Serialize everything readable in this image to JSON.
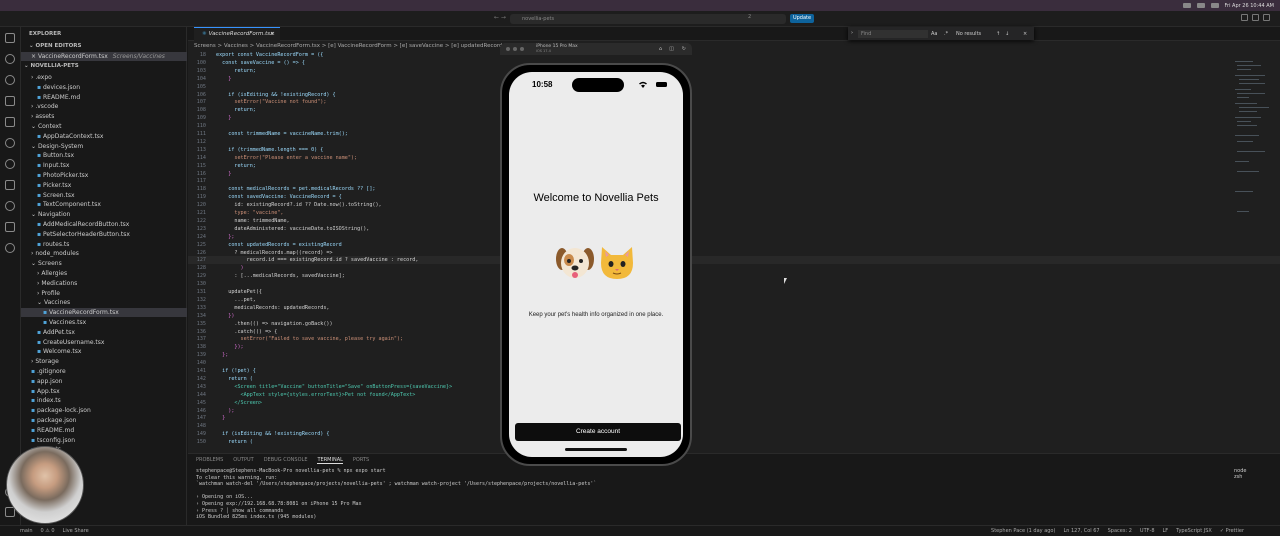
{
  "titlebar": {
    "search_text": "novellia-pets",
    "badge_count": "2",
    "update_label": "Update",
    "clock": "Fri Apr 26  10:44 AM"
  },
  "explorer": {
    "title": "EXPLORER",
    "open_editors_label": "OPEN EDITORS",
    "open_file": "VaccineRecordForm.tsx",
    "open_file_path": "Screens/Vaccines",
    "project_label": "NOVELLIA-PETS",
    "tree": [
      {
        "label": ".expo",
        "depth": 1,
        "kind": "folder"
      },
      {
        "label": "devices.json",
        "depth": 2,
        "kind": "file"
      },
      {
        "label": "README.md",
        "depth": 2,
        "kind": "file"
      },
      {
        "label": ".vscode",
        "depth": 1,
        "kind": "folder"
      },
      {
        "label": "assets",
        "depth": 1,
        "kind": "folder"
      },
      {
        "label": "Context",
        "depth": 1,
        "kind": "folder-open"
      },
      {
        "label": "AppDataContext.tsx",
        "depth": 2,
        "kind": "file"
      },
      {
        "label": "Design-System",
        "depth": 1,
        "kind": "folder-open"
      },
      {
        "label": "Button.tsx",
        "depth": 2,
        "kind": "file"
      },
      {
        "label": "Input.tsx",
        "depth": 2,
        "kind": "file"
      },
      {
        "label": "PhotoPicker.tsx",
        "depth": 2,
        "kind": "file"
      },
      {
        "label": "Picker.tsx",
        "depth": 2,
        "kind": "file"
      },
      {
        "label": "Screen.tsx",
        "depth": 2,
        "kind": "file"
      },
      {
        "label": "TextComponent.tsx",
        "depth": 2,
        "kind": "file"
      },
      {
        "label": "Navigation",
        "depth": 1,
        "kind": "folder-open"
      },
      {
        "label": "AddMedicalRecordButton.tsx",
        "depth": 2,
        "kind": "file"
      },
      {
        "label": "PetSelectorHeaderButton.tsx",
        "depth": 2,
        "kind": "file"
      },
      {
        "label": "routes.ts",
        "depth": 2,
        "kind": "file"
      },
      {
        "label": "node_modules",
        "depth": 1,
        "kind": "folder"
      },
      {
        "label": "Screens",
        "depth": 1,
        "kind": "folder-open"
      },
      {
        "label": "Allergies",
        "depth": 2,
        "kind": "folder"
      },
      {
        "label": "Medications",
        "depth": 2,
        "kind": "folder"
      },
      {
        "label": "Profile",
        "depth": 2,
        "kind": "folder"
      },
      {
        "label": "Vaccines",
        "depth": 2,
        "kind": "folder-open"
      },
      {
        "label": "VaccineRecordForm.tsx",
        "depth": 3,
        "kind": "file",
        "selected": true
      },
      {
        "label": "Vaccines.tsx",
        "depth": 3,
        "kind": "file"
      },
      {
        "label": "AddPet.tsx",
        "depth": 2,
        "kind": "file"
      },
      {
        "label": "CreateUsername.tsx",
        "depth": 2,
        "kind": "file"
      },
      {
        "label": "Welcome.tsx",
        "depth": 2,
        "kind": "file"
      },
      {
        "label": "Storage",
        "depth": 1,
        "kind": "folder"
      },
      {
        "label": ".gitignore",
        "depth": 1,
        "kind": "file"
      },
      {
        "label": "app.json",
        "depth": 1,
        "kind": "file"
      },
      {
        "label": "App.tsx",
        "depth": 1,
        "kind": "file"
      },
      {
        "label": "index.ts",
        "depth": 1,
        "kind": "file"
      },
      {
        "label": "package-lock.json",
        "depth": 1,
        "kind": "file"
      },
      {
        "label": "package.json",
        "depth": 1,
        "kind": "file"
      },
      {
        "label": "README.md",
        "depth": 1,
        "kind": "file"
      },
      {
        "label": "tsconfig.json",
        "depth": 1,
        "kind": "file"
      },
      {
        "label": "types.ts",
        "depth": 1,
        "kind": "file"
      }
    ]
  },
  "editor": {
    "tab_label": "VaccineRecordForm.tsx",
    "breadcrumbs": "Screens > Vaccines > VaccineRecordForm.tsx > [e] VaccineRecordForm > [e] saveVaccine > [e] updatedRecords",
    "active_line": "127",
    "lines": [
      {
        "n": "18",
        "t": "export const VaccineRecordForm = ({"
      },
      {
        "n": "100",
        "t": "  const saveVaccine = () => {"
      },
      {
        "n": "103",
        "t": "      return;"
      },
      {
        "n": "104",
        "t": "    }"
      },
      {
        "n": "105",
        "t": ""
      },
      {
        "n": "106",
        "t": "    if (isEditing && !existingRecord) {"
      },
      {
        "n": "107",
        "t": "      setError(\"Vaccine not found\");"
      },
      {
        "n": "108",
        "t": "      return;"
      },
      {
        "n": "109",
        "t": "    }"
      },
      {
        "n": "110",
        "t": ""
      },
      {
        "n": "111",
        "t": "    const trimmedName = vaccineName.trim();"
      },
      {
        "n": "112",
        "t": ""
      },
      {
        "n": "113",
        "t": "    if (trimmedName.length === 0) {"
      },
      {
        "n": "114",
        "t": "      setError(\"Please enter a vaccine name\");"
      },
      {
        "n": "115",
        "t": "      return;"
      },
      {
        "n": "116",
        "t": "    }"
      },
      {
        "n": "117",
        "t": ""
      },
      {
        "n": "118",
        "t": "    const medicalRecords = pet.medicalRecords ?? [];"
      },
      {
        "n": "119",
        "t": "    const savedVaccine: VaccineRecord = {"
      },
      {
        "n": "120",
        "t": "      id: existingRecord?.id ?? Date.now().toString(),"
      },
      {
        "n": "121",
        "t": "      type: \"vaccine\","
      },
      {
        "n": "122",
        "t": "      name: trimmedName,"
      },
      {
        "n": "123",
        "t": "      dateAdministered: vaccineDate.toISOString(),"
      },
      {
        "n": "124",
        "t": "    };"
      },
      {
        "n": "125",
        "t": "    const updatedRecords = existingRecord"
      },
      {
        "n": "126",
        "t": "      ? medicalRecords.map((record) =>"
      },
      {
        "n": "127",
        "t": "          record.id === existingRecord.id ? savedVaccine : record,"
      },
      {
        "n": "128",
        "t": "        )"
      },
      {
        "n": "129",
        "t": "      : [...medicalRecords, savedVaccine];"
      },
      {
        "n": "130",
        "t": ""
      },
      {
        "n": "131",
        "t": "    updatePet({"
      },
      {
        "n": "132",
        "t": "      ...pet,"
      },
      {
        "n": "133",
        "t": "      medicalRecords: updatedRecords,"
      },
      {
        "n": "134",
        "t": "    })"
      },
      {
        "n": "135",
        "t": "      .then(() => navigation.goBack())"
      },
      {
        "n": "136",
        "t": "      .catch(() => {"
      },
      {
        "n": "137",
        "t": "        setError(\"Failed to save vaccine, please try again\");"
      },
      {
        "n": "138",
        "t": "      });"
      },
      {
        "n": "139",
        "t": "  };"
      },
      {
        "n": "140",
        "t": ""
      },
      {
        "n": "141",
        "t": "  if (!pet) {"
      },
      {
        "n": "142",
        "t": "    return ("
      },
      {
        "n": "143",
        "t": "      <Screen title=\"Vaccine\" buttonTitle=\"Save\" onButtonPress={saveVaccine}>"
      },
      {
        "n": "144",
        "t": "        <AppText style={styles.errorText}>Pet not found</AppText>"
      },
      {
        "n": "145",
        "t": "      </Screen>"
      },
      {
        "n": "146",
        "t": "    );"
      },
      {
        "n": "147",
        "t": "  }"
      },
      {
        "n": "148",
        "t": ""
      },
      {
        "n": "149",
        "t": "  if (isEditing && !existingRecord) {"
      },
      {
        "n": "150",
        "t": "    return ("
      }
    ]
  },
  "find_widget": {
    "placeholder": "Find",
    "option_case": "Aa",
    "result": "No results"
  },
  "panel": {
    "tabs": [
      "PROBLEMS",
      "OUTPUT",
      "DEBUG CONSOLE",
      "TERMINAL",
      "PORTS"
    ],
    "active_tab": "TERMINAL",
    "terminal_lines": [
      "stephenpace@Stephens-MacBook-Pro novellia-pets % npx expo start",
      "To clear this warning, run:",
      "`watchman watch-del '/Users/stephenpace/projects/novellia-pets' ; watchman watch-project '/Users/stephenpace/projects/novellia-pets'`",
      "",
      "› Opening on iOS...",
      "› Opening exp://192.168.68.78:8081 on iPhone 15 Pro Max",
      "› Press ? │ show all commands",
      "iOS Bundled 825ms index.ts (945 modules)"
    ],
    "terminals": [
      "node",
      "zsh"
    ]
  },
  "statusbar": {
    "branch": "main",
    "problems": "0 ⚠ 0",
    "live_share": "Live Share",
    "blame": "Stephen Pace (1 day ago)",
    "position": "Ln 127, Col 67",
    "spaces": "Spaces: 2",
    "encoding": "UTF-8",
    "eol": "LF",
    "language": "TypeScript JSX",
    "formatter": "✓ Prettier"
  },
  "simulator": {
    "device_name": "iPhone 15 Pro Max",
    "os_version": "iOS 17.4",
    "time": "10:58",
    "welcome_title": "Welcome to Novellia Pets",
    "pet_icons": [
      "dog-face",
      "cat-face"
    ],
    "tagline": "Keep your pet's health info organized in one place.",
    "cta_label": "Create account"
  }
}
